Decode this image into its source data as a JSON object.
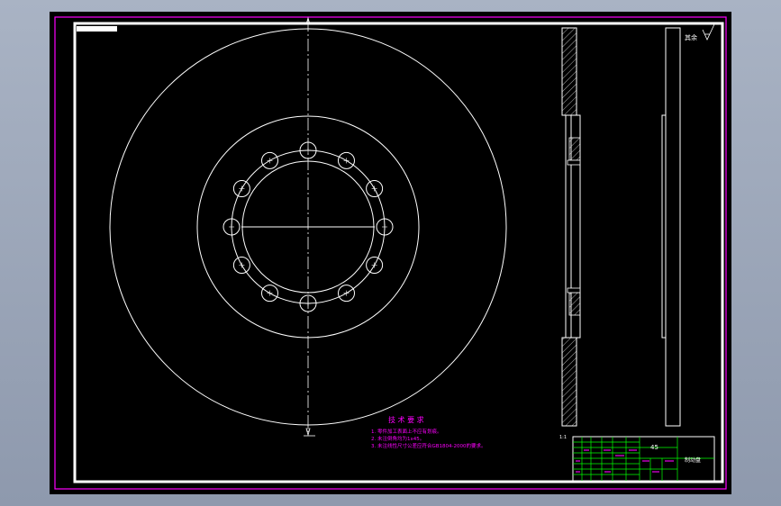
{
  "drawing": {
    "tech_requirements": {
      "title": "技 术 要 求",
      "lines": [
        "1. 零件加工表面上不应有划痕。",
        "2. 未注倒角均为1x45。",
        "3. 未注线性尺寸公差应符合GB1804-2000的要求。"
      ]
    },
    "roughness_note": "其余",
    "scale_note": "1:1",
    "title_block": {
      "material": "45",
      "part_name": "制动盘"
    },
    "colors": {
      "background": "#000000",
      "geometry": "#ffffff",
      "frame_outer": "#ff00ff",
      "annotation": "#ff00ff",
      "title_block": "#00ff00",
      "centerline": "#ffffff"
    }
  }
}
